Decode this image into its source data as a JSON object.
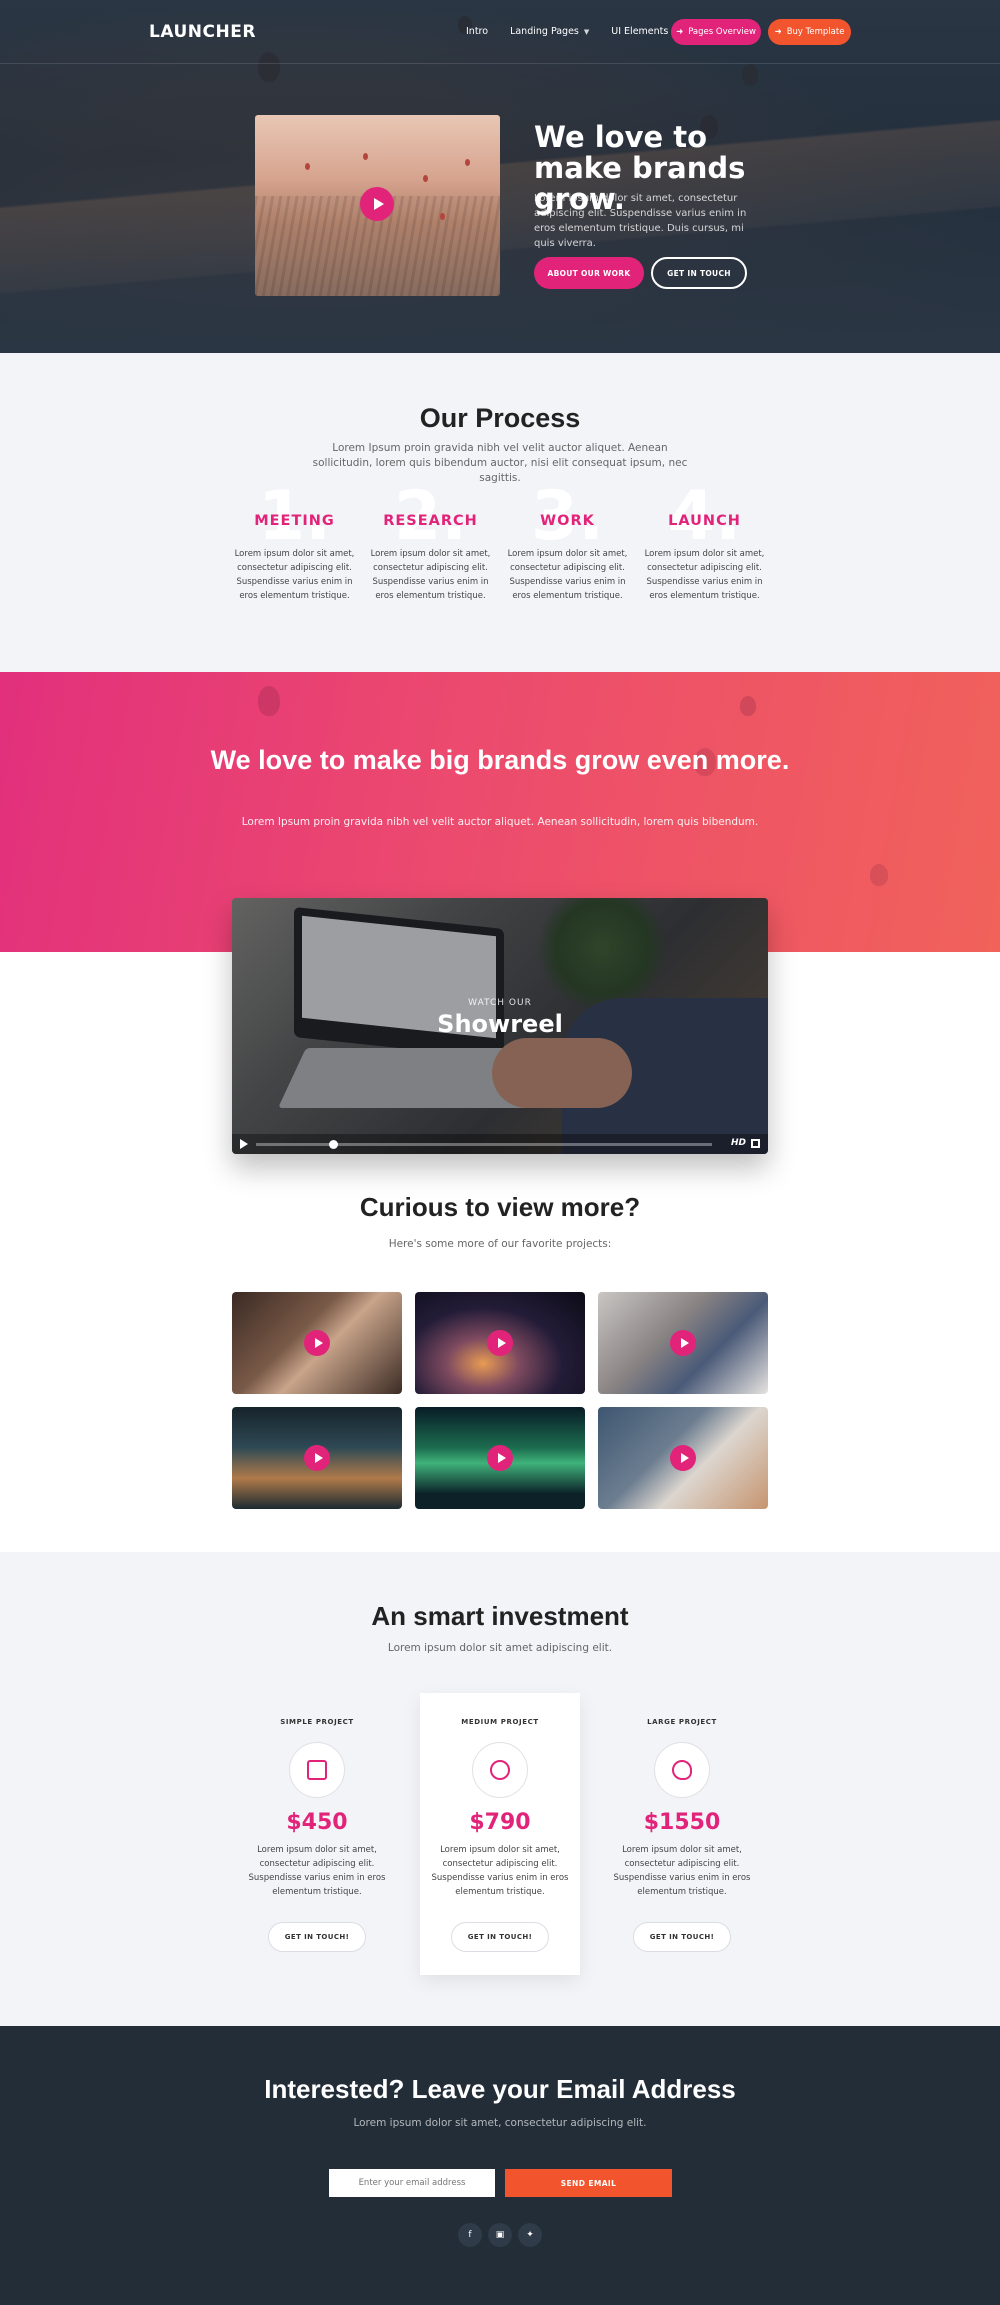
{
  "nav": {
    "logo": "LAUNCHER",
    "links": [
      "Intro",
      "Landing Pages",
      "UI Elements"
    ],
    "pages_overview": "Pages Overview",
    "buy_template": "Buy Template"
  },
  "hero": {
    "title": "We love to make brands grow.",
    "text": "Lorem ipsum dolor sit amet, consectetur adipiscing elit. Suspendisse varius enim in eros elementum tristique. Duis cursus, mi quis viverra.",
    "btn_work": "ABOUT OUR WORK",
    "btn_touch": "GET IN TOUCH"
  },
  "process": {
    "title": "Our Process",
    "subtitle": "Lorem Ipsum proin gravida nibh vel velit auctor aliquet. Aenean sollicitudin, lorem quis bibendum auctor, nisi elit consequat ipsum, nec sagittis.",
    "steps": [
      {
        "num": "1.",
        "label": "MEETING",
        "text": "Lorem ipsum dolor sit amet, consectetur adipiscing elit. Suspendisse varius enim in eros elementum tristique."
      },
      {
        "num": "2.",
        "label": "RESEARCH",
        "text": "Lorem ipsum dolor sit amet, consectetur adipiscing elit. Suspendisse varius enim in eros elementum tristique."
      },
      {
        "num": "3.",
        "label": "WORK",
        "text": "Lorem ipsum dolor sit amet, consectetur adipiscing elit. Suspendisse varius enim in eros elementum tristique."
      },
      {
        "num": "4.",
        "label": "LAUNCH",
        "text": "Lorem ipsum dolor sit amet, consectetur adipiscing elit. Suspendisse varius enim in eros elementum tristique."
      }
    ]
  },
  "brands": {
    "title": "We love to make big brands grow even more.",
    "subtitle": "Lorem Ipsum proin gravida nibh vel velit auctor aliquet. Aenean sollicitudin, lorem quis bibendum."
  },
  "video": {
    "watch": "WATCH OUR",
    "title": "Showreel",
    "hd": "HD",
    "progress": 0.16
  },
  "projects": {
    "title": "Curious to view more?",
    "subtitle": "Here's some more of our favorite projects:",
    "tiles": [
      "woman-phone",
      "night-sky",
      "office-team",
      "escalator",
      "aurora",
      "laptop-lap"
    ]
  },
  "pricing": {
    "title": "An smart investment",
    "subtitle": "Lorem ipsum dolor sit amet adipiscing elit.",
    "plans": [
      {
        "name": "SIMPLE PROJECT",
        "price": "$450",
        "text": "Lorem ipsum dolor sit amet, consectetur adipiscing elit. Suspendisse varius enim in eros elementum tristique.",
        "button": "GET IN TOUCH!"
      },
      {
        "name": "MEDIUM PROJECT",
        "price": "$790",
        "text": "Lorem ipsum dolor sit amet, consectetur adipiscing elit. Suspendisse varius enim in eros elementum tristique.",
        "button": "GET IN TOUCH!"
      },
      {
        "name": "LARGE PROJECT",
        "price": "$1550",
        "text": "Lorem ipsum dolor sit amet, consectetur adipiscing elit. Suspendisse varius enim in eros elementum tristique.",
        "button": "GET IN TOUCH!"
      }
    ]
  },
  "footer": {
    "title": "Interested? Leave your Email Address",
    "subtitle": "Lorem ipsum dolor sit amet, consectetur adipiscing elit.",
    "email_placeholder": "Enter your email address",
    "send": "SEND EMAIL",
    "social": [
      "facebook-icon",
      "instagram-icon",
      "twitter-icon"
    ]
  },
  "colors": {
    "accent": "#e2237a",
    "orange": "#f2542d",
    "dark": "#222d38"
  }
}
